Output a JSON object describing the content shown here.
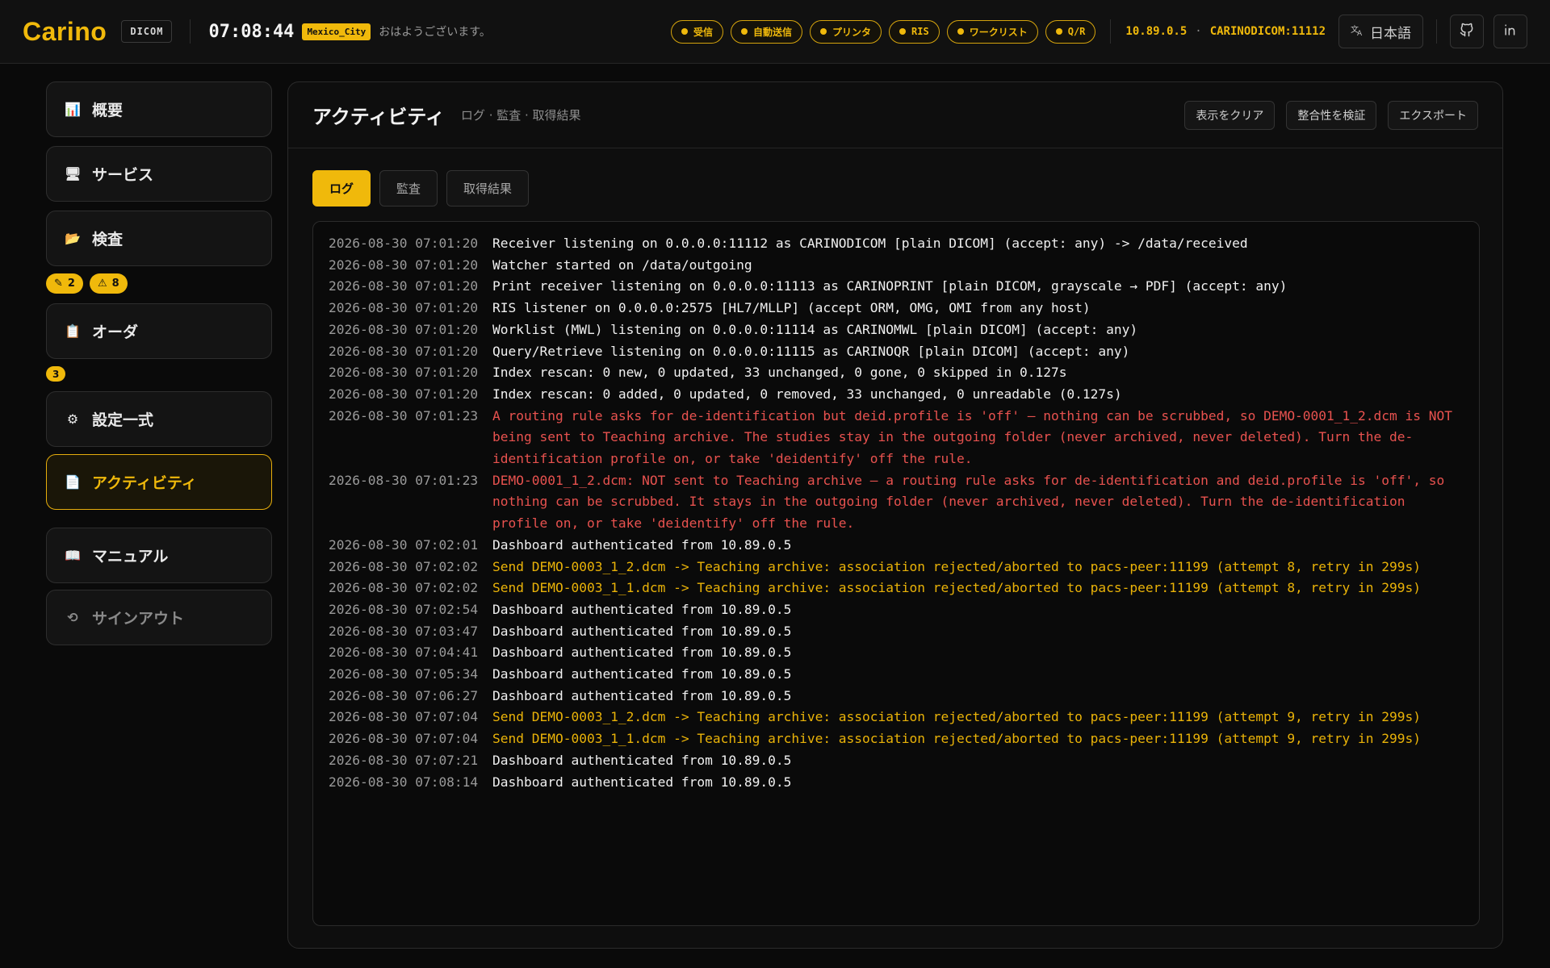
{
  "header": {
    "logo": "Carino",
    "logo_tag": "DICOM",
    "clock": "07:08:44",
    "timezone": "Mexico_City",
    "greeting": "おはようございます。",
    "services": [
      {
        "label": "受信",
        "mono": false
      },
      {
        "label": "自動送信",
        "mono": false
      },
      {
        "label": "プリンタ",
        "mono": false
      },
      {
        "label": "RIS",
        "mono": true
      },
      {
        "label": "ワークリスト",
        "mono": false
      },
      {
        "label": "Q/R",
        "mono": true
      }
    ],
    "ip": "10.89.0.5",
    "endpoint_sep": "·",
    "aet": "CARINODICOM:11112",
    "language": "日本語",
    "language_icon": "translate-icon",
    "accent": "#f0b90b"
  },
  "sidebar": {
    "items": [
      {
        "label": "概要",
        "icon": "chart-icon"
      },
      {
        "label": "サービス",
        "icon": "monitor-icon"
      },
      {
        "label": "検査",
        "icon": "folder-icon"
      },
      {
        "label": "オーダ",
        "icon": "clipboard-icon"
      },
      {
        "label": "設定一式",
        "icon": "gear-icon"
      },
      {
        "label": "アクティビティ",
        "icon": "document-icon"
      },
      {
        "label": "マニュアル",
        "icon": "book-icon"
      },
      {
        "label": "サインアウト",
        "icon": "signout-icon"
      }
    ],
    "study_badges": [
      {
        "icon": "pencil-icon",
        "glyph": "✎",
        "count": "2"
      },
      {
        "icon": "warning-icon",
        "glyph": "⚠",
        "count": "8"
      }
    ],
    "order_badge": "3"
  },
  "panel": {
    "title": "アクティビティ",
    "subtitle": "ログ · 監査 · 取得結果",
    "actions": [
      "表示をクリア",
      "整合性を検証",
      "エクスポート"
    ],
    "tabs": [
      "ログ",
      "監査",
      "取得結果"
    ]
  },
  "log": [
    {
      "ts": "2026-08-30 07:01:20",
      "level": "info",
      "msg": "Receiver listening on 0.0.0.0:11112 as CARINODICOM [plain DICOM] (accept: any) -> /data/received"
    },
    {
      "ts": "2026-08-30 07:01:20",
      "level": "info",
      "msg": "Watcher started on /data/outgoing"
    },
    {
      "ts": "2026-08-30 07:01:20",
      "level": "info",
      "msg": "Print receiver listening on 0.0.0.0:11113 as CARINOPRINT [plain DICOM, grayscale → PDF] (accept: any)"
    },
    {
      "ts": "2026-08-30 07:01:20",
      "level": "info",
      "msg": "RIS listener on 0.0.0.0:2575 [HL7/MLLP] (accept ORM, OMG, OMI from any host)"
    },
    {
      "ts": "2026-08-30 07:01:20",
      "level": "info",
      "msg": "Worklist (MWL) listening on 0.0.0.0:11114 as CARINOMWL [plain DICOM] (accept: any)"
    },
    {
      "ts": "2026-08-30 07:01:20",
      "level": "info",
      "msg": "Query/Retrieve listening on 0.0.0.0:11115 as CARINOQR [plain DICOM] (accept: any)"
    },
    {
      "ts": "2026-08-30 07:01:20",
      "level": "info",
      "msg": "Index rescan: 0 new, 0 updated, 33 unchanged, 0 gone, 0 skipped in 0.127s"
    },
    {
      "ts": "2026-08-30 07:01:20",
      "level": "info",
      "msg": "Index rescan: 0 added, 0 updated, 0 removed, 33 unchanged, 0 unreadable (0.127s)"
    },
    {
      "ts": "2026-08-30 07:01:23",
      "level": "error",
      "msg": "A routing rule asks for de-identification but deid.profile is 'off' — nothing can be scrubbed, so DEMO-0001_1_2.dcm is NOT being sent to Teaching archive. The studies stay in the outgoing folder (never archived, never deleted). Turn the de-identification profile on, or take 'deidentify' off the rule."
    },
    {
      "ts": "2026-08-30 07:01:23",
      "level": "error",
      "msg": "DEMO-0001_1_2.dcm: NOT sent to Teaching archive — a routing rule asks for de-identification and deid.profile is 'off', so nothing can be scrubbed. It stays in the outgoing folder (never archived, never deleted). Turn the de-identification profile on, or take 'deidentify' off the rule."
    },
    {
      "ts": "2026-08-30 07:02:01",
      "level": "info",
      "msg": "Dashboard authenticated from 10.89.0.5"
    },
    {
      "ts": "2026-08-30 07:02:02",
      "level": "warn",
      "msg": "Send DEMO-0003_1_2.dcm -> Teaching archive: association rejected/aborted to pacs-peer:11199 (attempt 8, retry in 299s)"
    },
    {
      "ts": "2026-08-30 07:02:02",
      "level": "warn",
      "msg": "Send DEMO-0003_1_1.dcm -> Teaching archive: association rejected/aborted to pacs-peer:11199 (attempt 8, retry in 299s)"
    },
    {
      "ts": "2026-08-30 07:02:54",
      "level": "info",
      "msg": "Dashboard authenticated from 10.89.0.5"
    },
    {
      "ts": "2026-08-30 07:03:47",
      "level": "info",
      "msg": "Dashboard authenticated from 10.89.0.5"
    },
    {
      "ts": "2026-08-30 07:04:41",
      "level": "info",
      "msg": "Dashboard authenticated from 10.89.0.5"
    },
    {
      "ts": "2026-08-30 07:05:34",
      "level": "info",
      "msg": "Dashboard authenticated from 10.89.0.5"
    },
    {
      "ts": "2026-08-30 07:06:27",
      "level": "info",
      "msg": "Dashboard authenticated from 10.89.0.5"
    },
    {
      "ts": "2026-08-30 07:07:04",
      "level": "warn",
      "msg": "Send DEMO-0003_1_2.dcm -> Teaching archive: association rejected/aborted to pacs-peer:11199 (attempt 9, retry in 299s)"
    },
    {
      "ts": "2026-08-30 07:07:04",
      "level": "warn",
      "msg": "Send DEMO-0003_1_1.dcm -> Teaching archive: association rejected/aborted to pacs-peer:11199 (attempt 9, retry in 299s)"
    },
    {
      "ts": "2026-08-30 07:07:21",
      "level": "info",
      "msg": "Dashboard authenticated from 10.89.0.5"
    },
    {
      "ts": "2026-08-30 07:08:14",
      "level": "info",
      "msg": "Dashboard authenticated from 10.89.0.5"
    }
  ]
}
